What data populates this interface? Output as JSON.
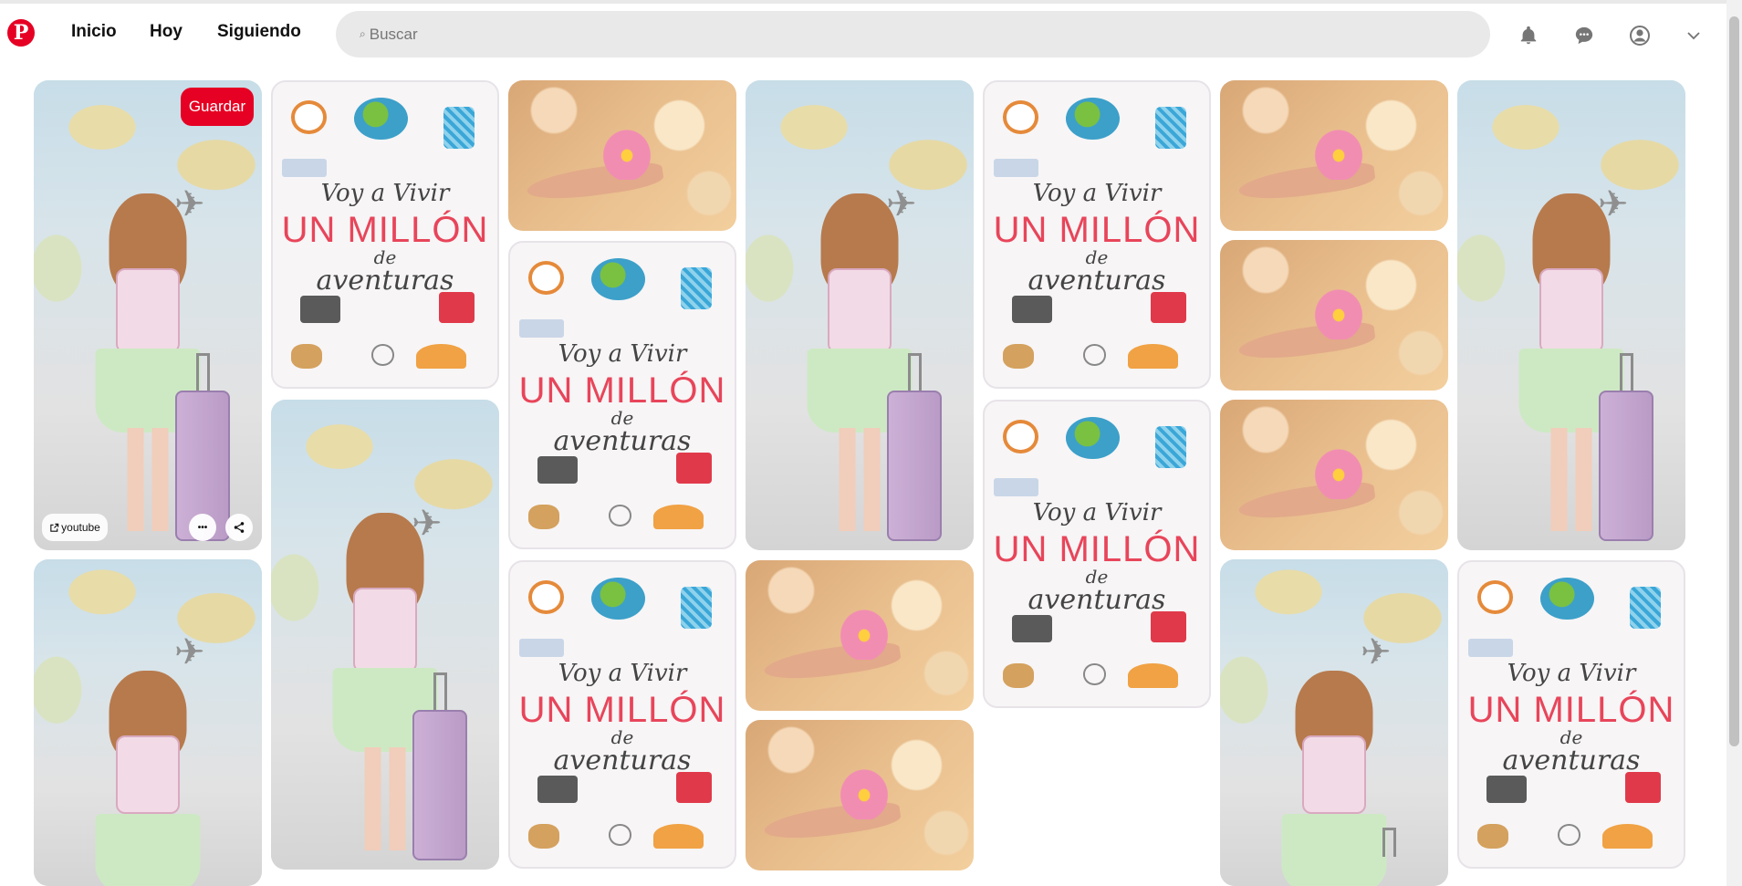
{
  "header": {
    "logo": "P",
    "nav": [
      "Inicio",
      "Hoy",
      "Siguiendo"
    ],
    "search_icon_glyph": "⌕",
    "search_placeholder": "Buscar",
    "icons": [
      "bell-icon",
      "chat-icon",
      "profile-icon",
      "chevron-down-icon"
    ]
  },
  "hovered_pin": {
    "save_label": "Guardar",
    "link_label": "youtube",
    "more_glyph": "•••",
    "share_glyph": "⤴"
  },
  "card_text": {
    "line1": "Voy a Vivir",
    "line2": "UN MILLÓN",
    "line3": "de",
    "line4": "aventuras"
  },
  "colors": {
    "brand": "#e60023",
    "search_bg": "#e9e9e9",
    "icon_gray": "#767676"
  }
}
